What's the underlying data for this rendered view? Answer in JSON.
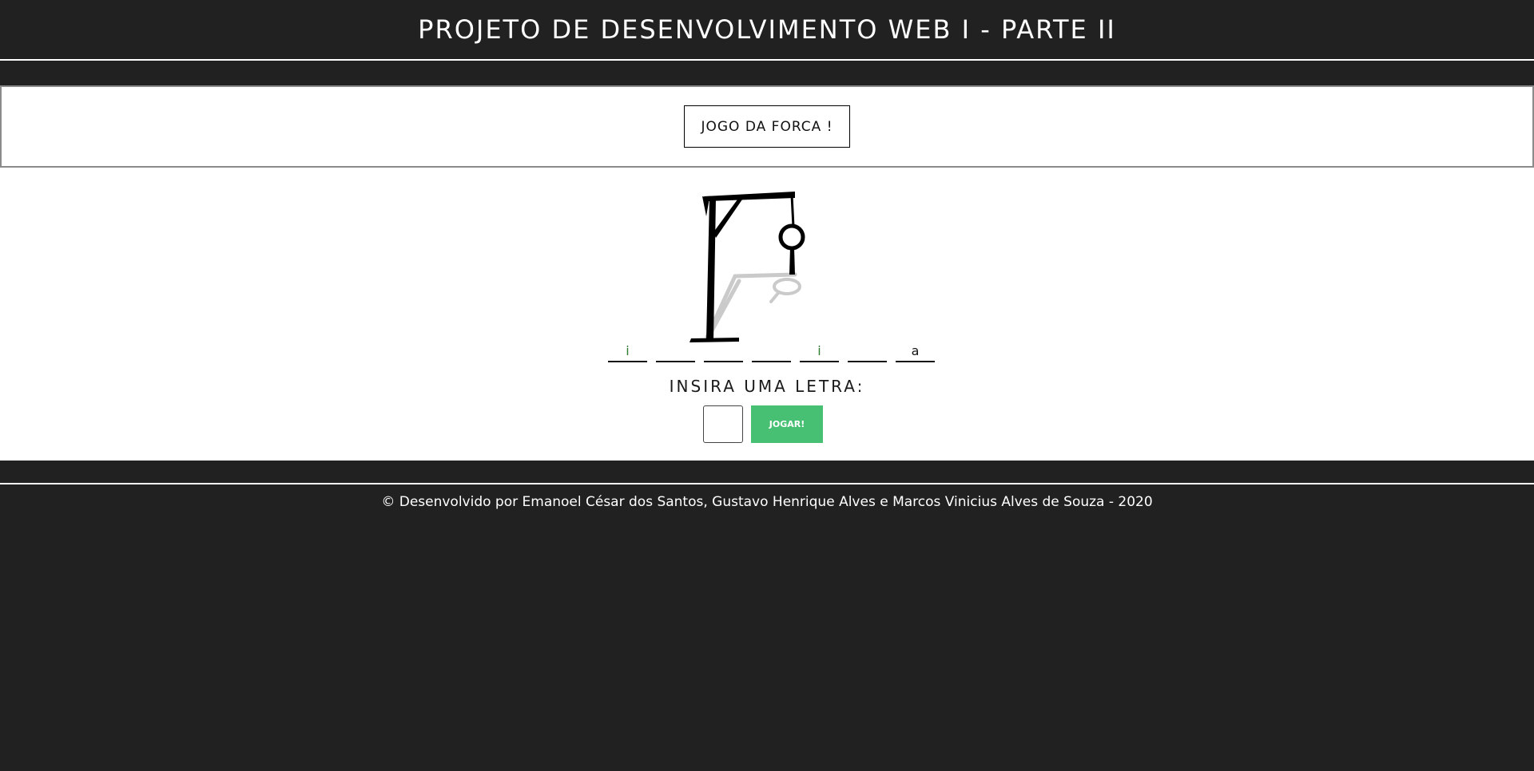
{
  "header": {
    "title": "PROJETO DE DESENVOLVIMENTO WEB I - PARTE II"
  },
  "game": {
    "title_button": "JOGO DA FORCA !",
    "word_slots": [
      "i",
      "",
      "",
      "",
      "i",
      "",
      "a"
    ],
    "prompt": "INSIRA UMA LETRA:",
    "letter_input_value": "",
    "play_button": "JOGAR!"
  },
  "footer": {
    "credits": "© Desenvolvido por Emanoel César dos Santos, Gustavo Henrique Alves e Marcos Vinicius Alves de Souza - 2020"
  },
  "colors": {
    "background": "#212121",
    "panel": "#ffffff",
    "accent_green": "#48c074",
    "text_dark": "#111111"
  }
}
